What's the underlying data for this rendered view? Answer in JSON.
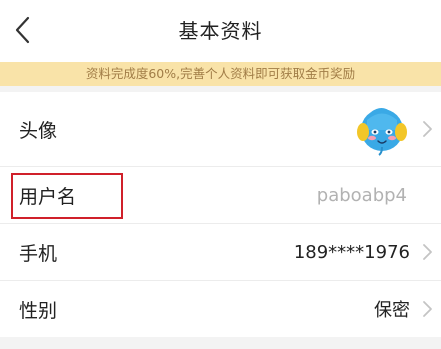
{
  "header": {
    "title": "基本资料"
  },
  "banner": {
    "text": "资料完成度60%,完善个人资料即可获取金币奖励"
  },
  "profile_rows": [
    {
      "label": "头像",
      "value": ""
    },
    {
      "label": "用户名",
      "value": "paboabp4"
    },
    {
      "label": "手机",
      "value": "189****1976"
    },
    {
      "label": "性别",
      "value": "保密"
    }
  ],
  "icons": {
    "back": "chevron-left-icon",
    "row_arrow": "chevron-right-icon"
  },
  "colors": {
    "banner_bg": "#f9e3a8",
    "banner_text": "#a17d47",
    "highlight": "#d0202a",
    "value_muted": "#b2b2b2"
  }
}
